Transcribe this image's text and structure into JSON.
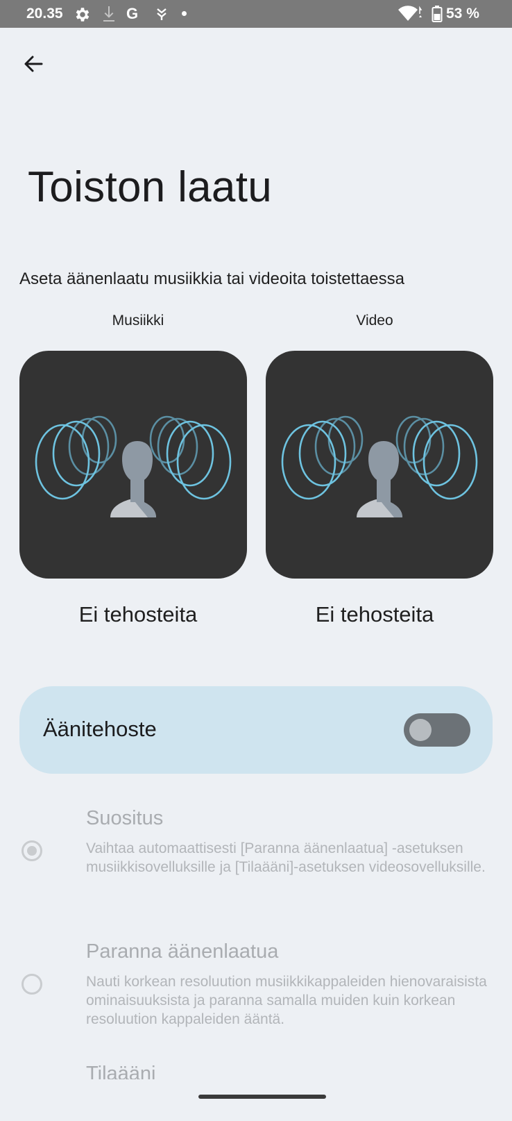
{
  "status_bar": {
    "time": "20.35",
    "google_letter": "G",
    "battery_text": "53 %",
    "icons": [
      "gear-icon",
      "download-icon",
      "google-icon",
      "app-notification-icon",
      "dot-icon",
      "wifi-icon",
      "battery-icon"
    ]
  },
  "header": {
    "title": "Toiston laatu",
    "description": "Aseta äänenlaatu musiikkia tai videoita toistettaessa"
  },
  "cards": [
    {
      "label": "Musiikki",
      "caption": "Ei tehosteita"
    },
    {
      "label": "Video",
      "caption": "Ei tehosteita"
    }
  ],
  "sound_effect": {
    "label": "Äänitehoste",
    "enabled": false
  },
  "options": [
    {
      "title": "Suositus",
      "subtitle": "Vaihtaa automaattisesti [Paranna äänenlaatua] -asetuksen musiikkisovelluksille ja [Tilaääni]-asetuksen videosovelluksille.",
      "selected": true
    },
    {
      "title": "Paranna äänenlaatua",
      "subtitle": "Nauti korkean resoluution musiikkikappaleiden hienovaraisista ominaisuuksista ja paranna samalla muiden kuin korkean resoluution kappaleiden ääntä.",
      "selected": false
    },
    {
      "title": "Tilaääni",
      "selected": false
    }
  ],
  "colors": {
    "background": "#edf0f4",
    "card_bg": "#333333",
    "ring_bright": "#6ec3e0",
    "ring_dim": "#5b8fa3",
    "effect_row_bg": "#cfe4ef",
    "disabled_text": "#a9acb0"
  }
}
